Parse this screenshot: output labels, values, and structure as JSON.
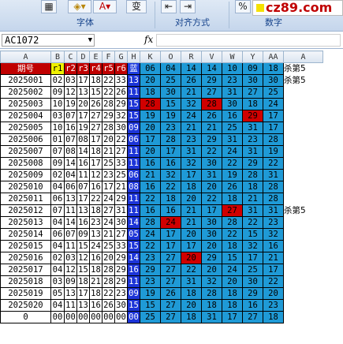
{
  "ribbon": {
    "groups": [
      "字体",
      "对齐方式",
      "数字"
    ],
    "font_letter": "A",
    "wrap_label": "变"
  },
  "logo_text": "cz89.com",
  "name_box": "AC1072",
  "formula_symbol": "fx",
  "columns": [
    "A",
    "B",
    "C",
    "D",
    "E",
    "F",
    "G",
    "H",
    "K",
    "O",
    "R",
    "V",
    "W",
    "Y",
    "AA",
    "A"
  ],
  "header": {
    "period": "期号",
    "reds": [
      "r1",
      "r2",
      "r3",
      "r4",
      "r5",
      "r6"
    ],
    "blue": "蓝",
    "nums": [
      "06",
      "04",
      "14",
      "14",
      "10",
      "09",
      "18"
    ],
    "right": "杀第5"
  },
  "rows": [
    {
      "id": "2025001",
      "reds": [
        "02",
        "03",
        "17",
        "18",
        "22",
        "33"
      ],
      "blue": "13",
      "n": [
        "20",
        "25",
        "26",
        "29",
        "23",
        "30",
        "30"
      ],
      "hit": [],
      "right": "杀第5"
    },
    {
      "id": "2025002",
      "reds": [
        "09",
        "12",
        "13",
        "15",
        "22",
        "26"
      ],
      "blue": "11",
      "n": [
        "18",
        "30",
        "21",
        "27",
        "31",
        "27",
        "25"
      ],
      "hit": [],
      "right": ""
    },
    {
      "id": "2025003",
      "reds": [
        "10",
        "19",
        "20",
        "26",
        "28",
        "29"
      ],
      "blue": "15",
      "n": [
        "28",
        "15",
        "32",
        "28",
        "30",
        "18",
        "24"
      ],
      "hit": [
        0,
        3
      ],
      "right": ""
    },
    {
      "id": "2025004",
      "reds": [
        "03",
        "07",
        "17",
        "27",
        "29",
        "32"
      ],
      "blue": "15",
      "n": [
        "19",
        "19",
        "24",
        "26",
        "16",
        "29",
        "17"
      ],
      "hit": [
        5
      ],
      "right": ""
    },
    {
      "id": "2025005",
      "reds": [
        "10",
        "16",
        "19",
        "27",
        "28",
        "30"
      ],
      "blue": "09",
      "n": [
        "20",
        "23",
        "21",
        "21",
        "25",
        "31",
        "17"
      ],
      "hit": [],
      "right": ""
    },
    {
      "id": "2025006",
      "reds": [
        "01",
        "07",
        "08",
        "17",
        "20",
        "22"
      ],
      "blue": "06",
      "n": [
        "17",
        "28",
        "23",
        "29",
        "31",
        "23",
        "28"
      ],
      "hit": [],
      "right": ""
    },
    {
      "id": "2025007",
      "reds": [
        "07",
        "08",
        "14",
        "18",
        "21",
        "27"
      ],
      "blue": "11",
      "n": [
        "20",
        "17",
        "31",
        "22",
        "24",
        "31",
        "19"
      ],
      "hit": [],
      "right": ""
    },
    {
      "id": "2025008",
      "reds": [
        "09",
        "14",
        "16",
        "17",
        "25",
        "33"
      ],
      "blue": "11",
      "n": [
        "16",
        "16",
        "32",
        "30",
        "22",
        "29",
        "22"
      ],
      "hit": [],
      "right": ""
    },
    {
      "id": "2025009",
      "reds": [
        "02",
        "04",
        "11",
        "12",
        "23",
        "25"
      ],
      "blue": "06",
      "n": [
        "21",
        "32",
        "17",
        "31",
        "19",
        "28",
        "31"
      ],
      "hit": [],
      "right": ""
    },
    {
      "id": "2025010",
      "reds": [
        "04",
        "06",
        "07",
        "16",
        "17",
        "21"
      ],
      "blue": "08",
      "n": [
        "16",
        "22",
        "18",
        "20",
        "26",
        "18",
        "28"
      ],
      "hit": [],
      "right": ""
    },
    {
      "id": "2025011",
      "reds": [
        "06",
        "13",
        "17",
        "22",
        "24",
        "29"
      ],
      "blue": "11",
      "n": [
        "22",
        "18",
        "20",
        "22",
        "18",
        "21",
        "28"
      ],
      "hit": [],
      "right": ""
    },
    {
      "id": "2025012",
      "reds": [
        "07",
        "11",
        "13",
        "18",
        "27",
        "31"
      ],
      "blue": "11",
      "n": [
        "16",
        "16",
        "21",
        "17",
        "27",
        "31",
        "31"
      ],
      "hit": [
        4
      ],
      "right": "杀第5"
    },
    {
      "id": "2025013",
      "reds": [
        "04",
        "14",
        "16",
        "23",
        "24",
        "30"
      ],
      "blue": "14",
      "n": [
        "28",
        "24",
        "21",
        "30",
        "28",
        "22",
        "23"
      ],
      "hit": [
        1
      ],
      "right": ""
    },
    {
      "id": "2025014",
      "reds": [
        "06",
        "07",
        "09",
        "13",
        "21",
        "27"
      ],
      "blue": "05",
      "n": [
        "24",
        "17",
        "20",
        "30",
        "22",
        "15",
        "32"
      ],
      "hit": [],
      "right": ""
    },
    {
      "id": "2025015",
      "reds": [
        "04",
        "11",
        "15",
        "24",
        "25",
        "33"
      ],
      "blue": "15",
      "n": [
        "22",
        "17",
        "17",
        "20",
        "18",
        "32",
        "16"
      ],
      "hit": [],
      "right": ""
    },
    {
      "id": "2025016",
      "reds": [
        "02",
        "03",
        "12",
        "16",
        "20",
        "29"
      ],
      "blue": "14",
      "n": [
        "23",
        "27",
        "20",
        "29",
        "15",
        "17",
        "21"
      ],
      "hit": [
        2
      ],
      "right": ""
    },
    {
      "id": "2025017",
      "reds": [
        "04",
        "12",
        "15",
        "18",
        "28",
        "29"
      ],
      "blue": "16",
      "n": [
        "29",
        "27",
        "22",
        "20",
        "24",
        "25",
        "17"
      ],
      "hit": [],
      "right": ""
    },
    {
      "id": "2025018",
      "reds": [
        "03",
        "09",
        "18",
        "21",
        "28",
        "29"
      ],
      "blue": "11",
      "n": [
        "23",
        "27",
        "31",
        "32",
        "20",
        "30",
        "22"
      ],
      "hit": [],
      "right": ""
    },
    {
      "id": "2025019",
      "reds": [
        "05",
        "13",
        "17",
        "18",
        "22",
        "23"
      ],
      "blue": "09",
      "n": [
        "19",
        "26",
        "18",
        "28",
        "18",
        "29",
        "20"
      ],
      "hit": [],
      "right": ""
    },
    {
      "id": "2025020",
      "reds": [
        "04",
        "11",
        "13",
        "16",
        "26",
        "30"
      ],
      "blue": "15",
      "n": [
        "15",
        "27",
        "20",
        "18",
        "18",
        "16",
        "23"
      ],
      "hit": [],
      "right": ""
    },
    {
      "id": "0",
      "reds": [
        "00",
        "00",
        "00",
        "00",
        "00",
        "00"
      ],
      "blue": "00",
      "n": [
        "25",
        "27",
        "18",
        "31",
        "17",
        "27",
        "18"
      ],
      "hit": [],
      "right": ""
    }
  ]
}
